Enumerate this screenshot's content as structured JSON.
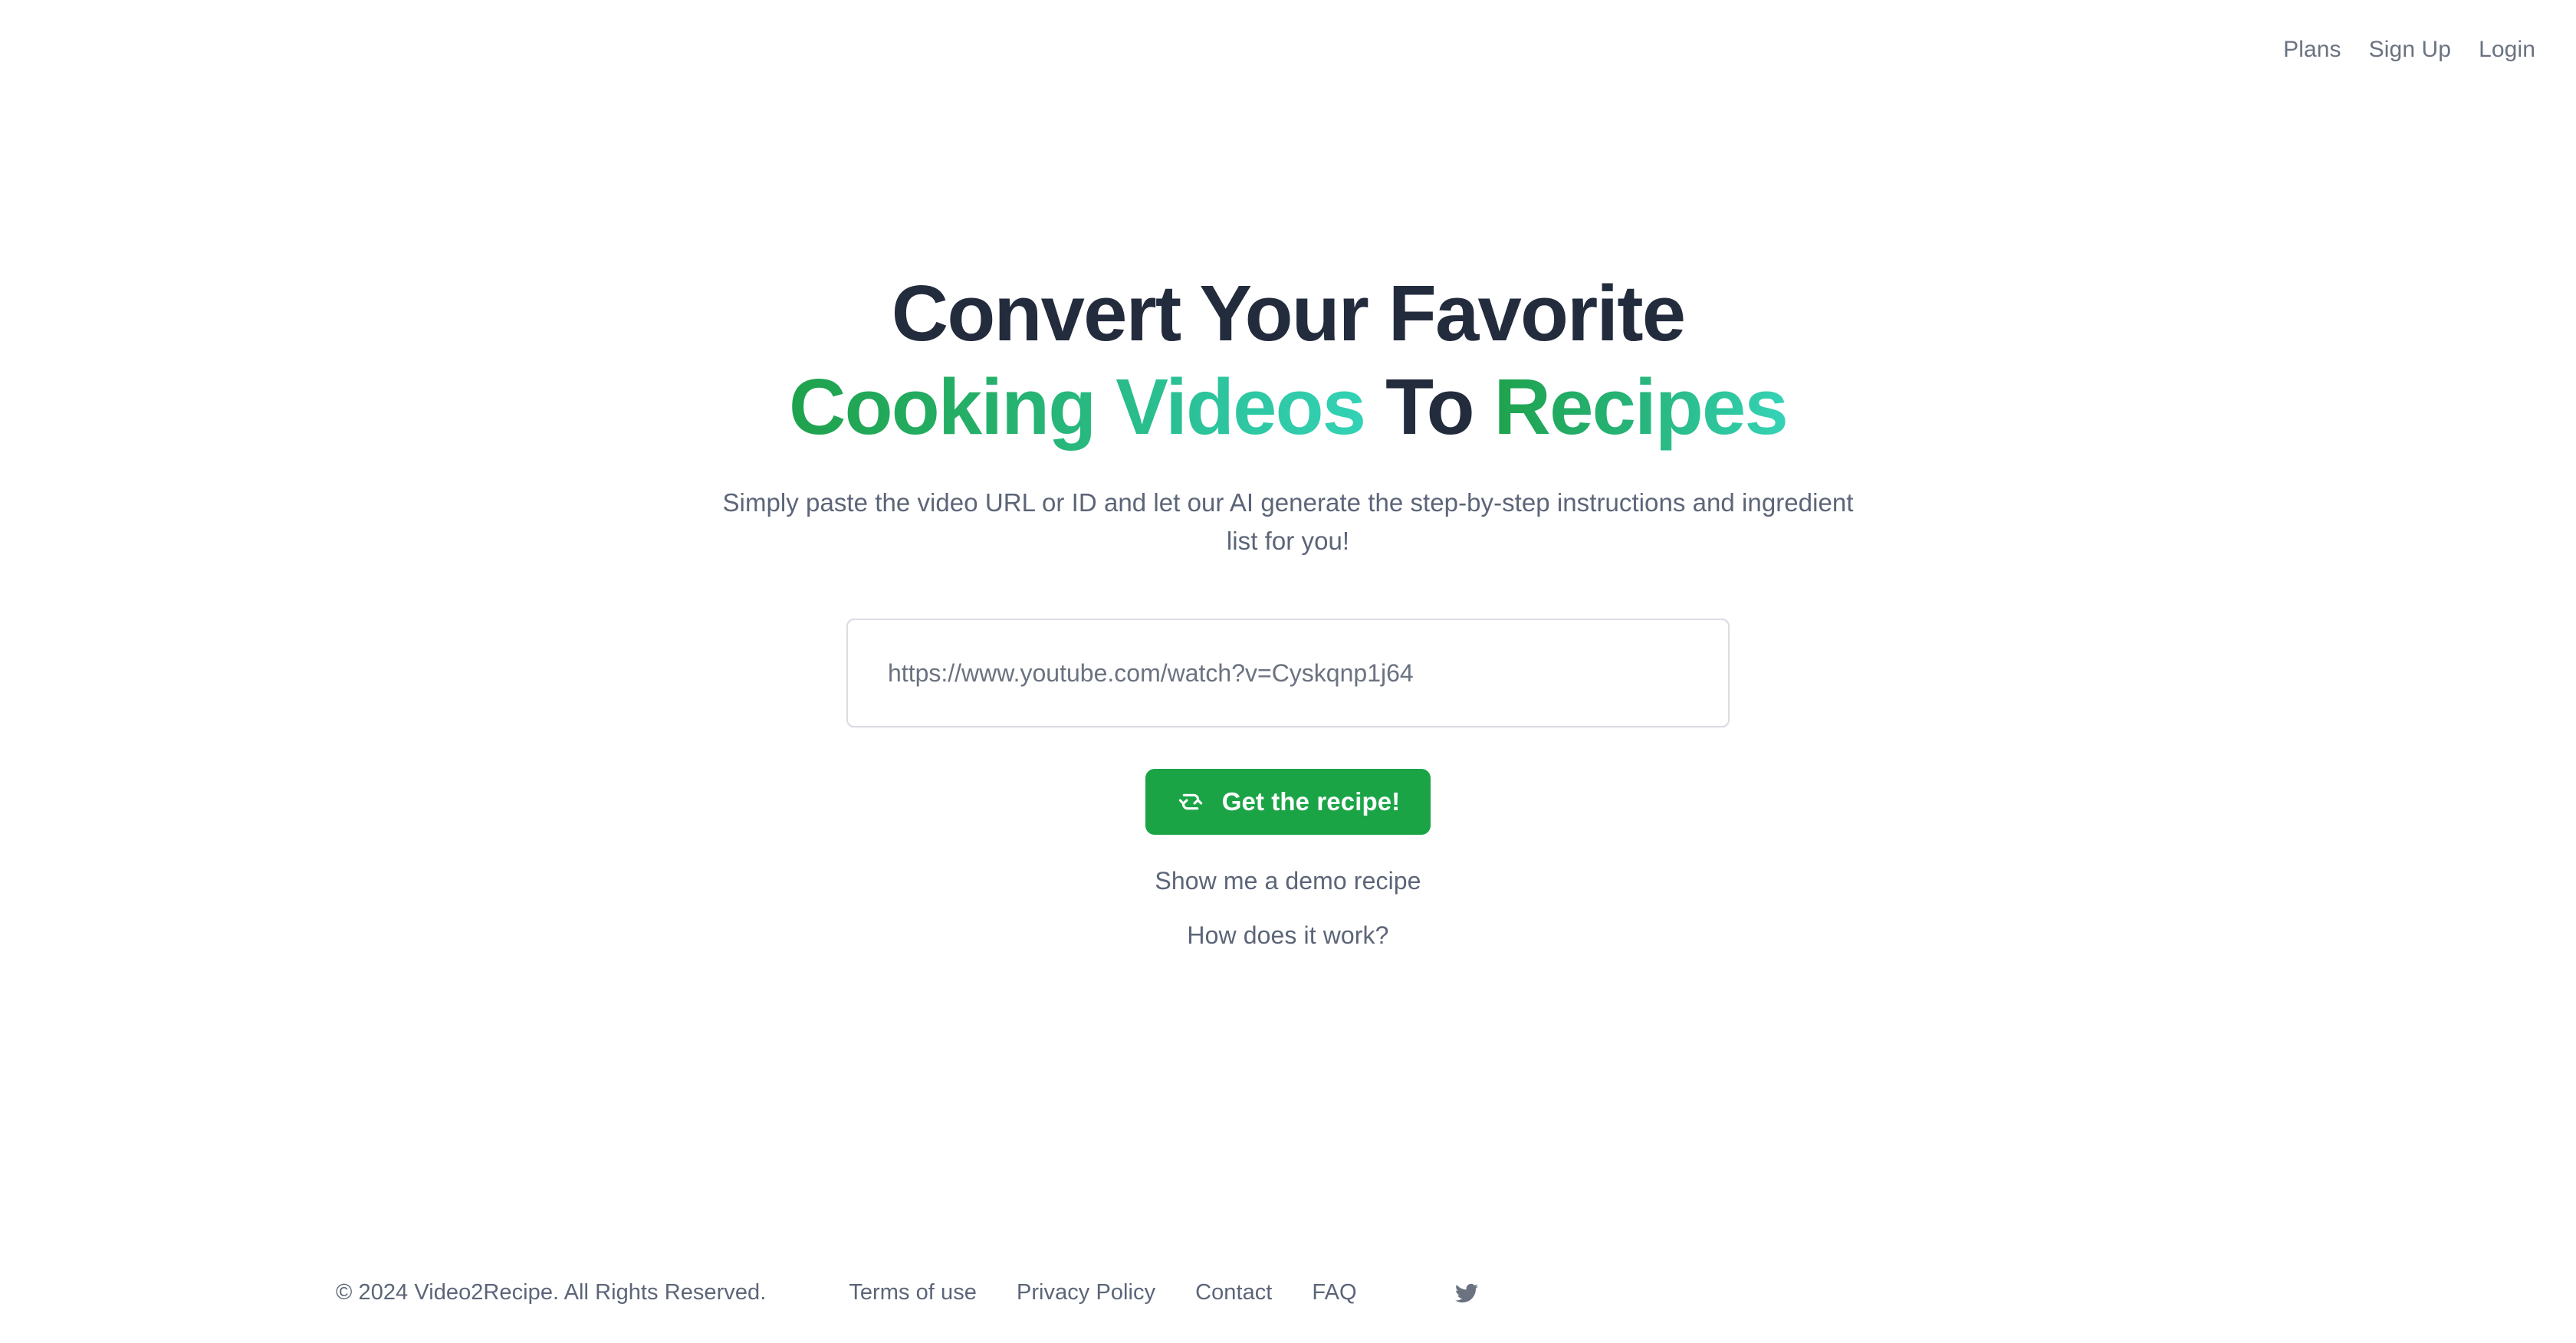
{
  "site": {
    "name": "Video2Recipe",
    "accent_green": "#1ba446",
    "gradient_start": "#1fa24c",
    "gradient_end": "#33d2b6",
    "heading_dark": "#232c3d",
    "muted_text": "#5c6578",
    "background": "#ffffff"
  },
  "topnav": {
    "links": [
      {
        "label": "Plans",
        "name": "nav-link-plans"
      },
      {
        "label": "Sign Up",
        "name": "nav-link-sign-up"
      },
      {
        "label": "Login",
        "name": "nav-link-login"
      }
    ]
  },
  "hero": {
    "headline": {
      "line1": "Convert Your Favorite",
      "line2_part1": "Cooking Videos",
      "line2_part2": "To",
      "line2_part3": "Recipes"
    },
    "subtitle": "Simply paste the video URL or ID and let our AI generate the step-by-step instructions and ingredient list for you!",
    "url_input": {
      "placeholder": "https://www.youtube.com/watch?v=Cyskqnp1j64",
      "value": ""
    },
    "cta": {
      "label": "Get the recipe!",
      "icon": "refresh-sync-icon"
    },
    "demo_link": "Show me a demo recipe",
    "how_link": "How does it work?"
  },
  "footer": {
    "copyright": "© 2024 Video2Recipe. All Rights Reserved.",
    "links": [
      {
        "label": "Terms of use",
        "name": "footer-link-terms-of-use"
      },
      {
        "label": "Privacy Policy",
        "name": "footer-link-privacy-policy"
      },
      {
        "label": "Contact",
        "name": "footer-link-contact"
      },
      {
        "label": "FAQ",
        "name": "footer-link-faq"
      }
    ],
    "social": [
      {
        "icon": "twitter-icon",
        "label": "Twitter"
      }
    ]
  }
}
